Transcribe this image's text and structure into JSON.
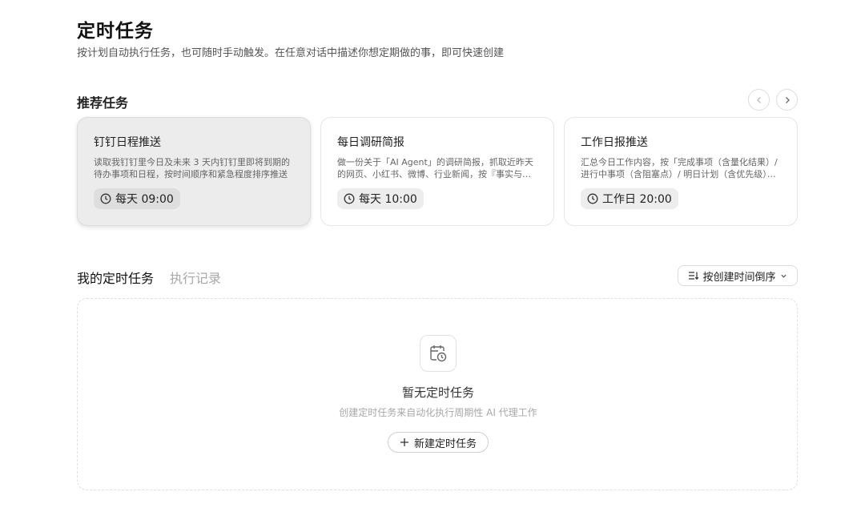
{
  "header": {
    "title": "定时任务",
    "subtitle": "按计划自动执行任务，也可随时手动触发。在任意对话中描述你想定期做的事，即可快速创建"
  },
  "recommended": {
    "title": "推荐任务",
    "cards": [
      {
        "title": "钉钉日程推送",
        "desc": "读取我钉钉里今日及未来 3 天内钉钉里即将到期的待办事项和日程，按时间顺序和紧急程度排序推送",
        "schedule": "每天 09:00"
      },
      {
        "title": "每日调研简报",
        "desc": "做一份关于「AI Agent」的调研简报，抓取近昨天的网页、小红书、微博、行业新闻，按『事实与观点』整理",
        "schedule": "每天 10:00"
      },
      {
        "title": "工作日报推送",
        "desc": "汇总今日工作内容，按「完成事项（含量化结果）/ 进行中事项（含阻塞点）/ 明日计划（含优先级）」整理",
        "schedule": "工作日 20:00"
      }
    ]
  },
  "tabs": {
    "mine": "我的定时任务",
    "history": "执行记录"
  },
  "sort": {
    "label": "按创建时间倒序"
  },
  "empty": {
    "title": "暂无定时任务",
    "desc": "创建定时任务来自动化执行周期性 AI 代理工作",
    "button": "新建定时任务"
  },
  "icons": {
    "prev": "chevron-left-icon",
    "next": "chevron-right-icon",
    "clock": "clock-icon",
    "sort": "sort-icon",
    "dropdown": "chevron-down-icon",
    "empty": "calendar-clock-icon",
    "plus": "plus-icon"
  },
  "colors": {
    "active_card_bg": "#ececec",
    "badge_bg": "#ededed",
    "muted_text": "#a8a8a8"
  }
}
